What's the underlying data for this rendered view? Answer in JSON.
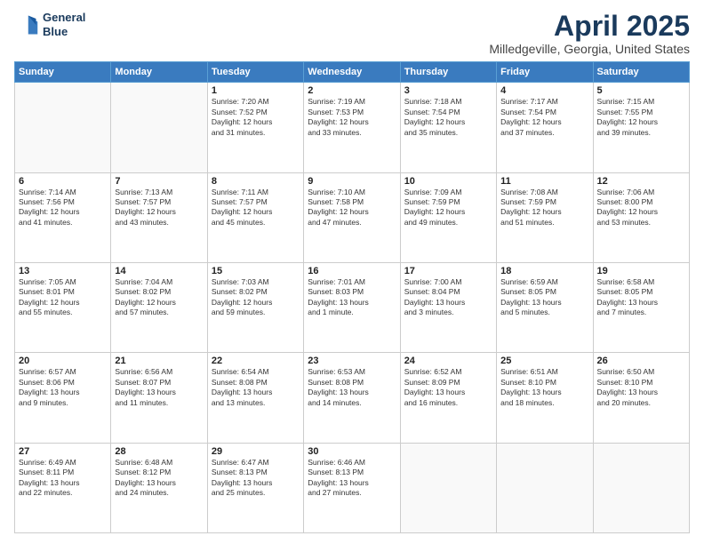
{
  "header": {
    "logo_line1": "General",
    "logo_line2": "Blue",
    "title": "April 2025",
    "subtitle": "Milledgeville, Georgia, United States"
  },
  "days_of_week": [
    "Sunday",
    "Monday",
    "Tuesday",
    "Wednesday",
    "Thursday",
    "Friday",
    "Saturday"
  ],
  "weeks": [
    [
      {
        "day": "",
        "info": ""
      },
      {
        "day": "",
        "info": ""
      },
      {
        "day": "1",
        "info": "Sunrise: 7:20 AM\nSunset: 7:52 PM\nDaylight: 12 hours\nand 31 minutes."
      },
      {
        "day": "2",
        "info": "Sunrise: 7:19 AM\nSunset: 7:53 PM\nDaylight: 12 hours\nand 33 minutes."
      },
      {
        "day": "3",
        "info": "Sunrise: 7:18 AM\nSunset: 7:54 PM\nDaylight: 12 hours\nand 35 minutes."
      },
      {
        "day": "4",
        "info": "Sunrise: 7:17 AM\nSunset: 7:54 PM\nDaylight: 12 hours\nand 37 minutes."
      },
      {
        "day": "5",
        "info": "Sunrise: 7:15 AM\nSunset: 7:55 PM\nDaylight: 12 hours\nand 39 minutes."
      }
    ],
    [
      {
        "day": "6",
        "info": "Sunrise: 7:14 AM\nSunset: 7:56 PM\nDaylight: 12 hours\nand 41 minutes."
      },
      {
        "day": "7",
        "info": "Sunrise: 7:13 AM\nSunset: 7:57 PM\nDaylight: 12 hours\nand 43 minutes."
      },
      {
        "day": "8",
        "info": "Sunrise: 7:11 AM\nSunset: 7:57 PM\nDaylight: 12 hours\nand 45 minutes."
      },
      {
        "day": "9",
        "info": "Sunrise: 7:10 AM\nSunset: 7:58 PM\nDaylight: 12 hours\nand 47 minutes."
      },
      {
        "day": "10",
        "info": "Sunrise: 7:09 AM\nSunset: 7:59 PM\nDaylight: 12 hours\nand 49 minutes."
      },
      {
        "day": "11",
        "info": "Sunrise: 7:08 AM\nSunset: 7:59 PM\nDaylight: 12 hours\nand 51 minutes."
      },
      {
        "day": "12",
        "info": "Sunrise: 7:06 AM\nSunset: 8:00 PM\nDaylight: 12 hours\nand 53 minutes."
      }
    ],
    [
      {
        "day": "13",
        "info": "Sunrise: 7:05 AM\nSunset: 8:01 PM\nDaylight: 12 hours\nand 55 minutes."
      },
      {
        "day": "14",
        "info": "Sunrise: 7:04 AM\nSunset: 8:02 PM\nDaylight: 12 hours\nand 57 minutes."
      },
      {
        "day": "15",
        "info": "Sunrise: 7:03 AM\nSunset: 8:02 PM\nDaylight: 12 hours\nand 59 minutes."
      },
      {
        "day": "16",
        "info": "Sunrise: 7:01 AM\nSunset: 8:03 PM\nDaylight: 13 hours\nand 1 minute."
      },
      {
        "day": "17",
        "info": "Sunrise: 7:00 AM\nSunset: 8:04 PM\nDaylight: 13 hours\nand 3 minutes."
      },
      {
        "day": "18",
        "info": "Sunrise: 6:59 AM\nSunset: 8:05 PM\nDaylight: 13 hours\nand 5 minutes."
      },
      {
        "day": "19",
        "info": "Sunrise: 6:58 AM\nSunset: 8:05 PM\nDaylight: 13 hours\nand 7 minutes."
      }
    ],
    [
      {
        "day": "20",
        "info": "Sunrise: 6:57 AM\nSunset: 8:06 PM\nDaylight: 13 hours\nand 9 minutes."
      },
      {
        "day": "21",
        "info": "Sunrise: 6:56 AM\nSunset: 8:07 PM\nDaylight: 13 hours\nand 11 minutes."
      },
      {
        "day": "22",
        "info": "Sunrise: 6:54 AM\nSunset: 8:08 PM\nDaylight: 13 hours\nand 13 minutes."
      },
      {
        "day": "23",
        "info": "Sunrise: 6:53 AM\nSunset: 8:08 PM\nDaylight: 13 hours\nand 14 minutes."
      },
      {
        "day": "24",
        "info": "Sunrise: 6:52 AM\nSunset: 8:09 PM\nDaylight: 13 hours\nand 16 minutes."
      },
      {
        "day": "25",
        "info": "Sunrise: 6:51 AM\nSunset: 8:10 PM\nDaylight: 13 hours\nand 18 minutes."
      },
      {
        "day": "26",
        "info": "Sunrise: 6:50 AM\nSunset: 8:10 PM\nDaylight: 13 hours\nand 20 minutes."
      }
    ],
    [
      {
        "day": "27",
        "info": "Sunrise: 6:49 AM\nSunset: 8:11 PM\nDaylight: 13 hours\nand 22 minutes."
      },
      {
        "day": "28",
        "info": "Sunrise: 6:48 AM\nSunset: 8:12 PM\nDaylight: 13 hours\nand 24 minutes."
      },
      {
        "day": "29",
        "info": "Sunrise: 6:47 AM\nSunset: 8:13 PM\nDaylight: 13 hours\nand 25 minutes."
      },
      {
        "day": "30",
        "info": "Sunrise: 6:46 AM\nSunset: 8:13 PM\nDaylight: 13 hours\nand 27 minutes."
      },
      {
        "day": "",
        "info": ""
      },
      {
        "day": "",
        "info": ""
      },
      {
        "day": "",
        "info": ""
      }
    ]
  ]
}
